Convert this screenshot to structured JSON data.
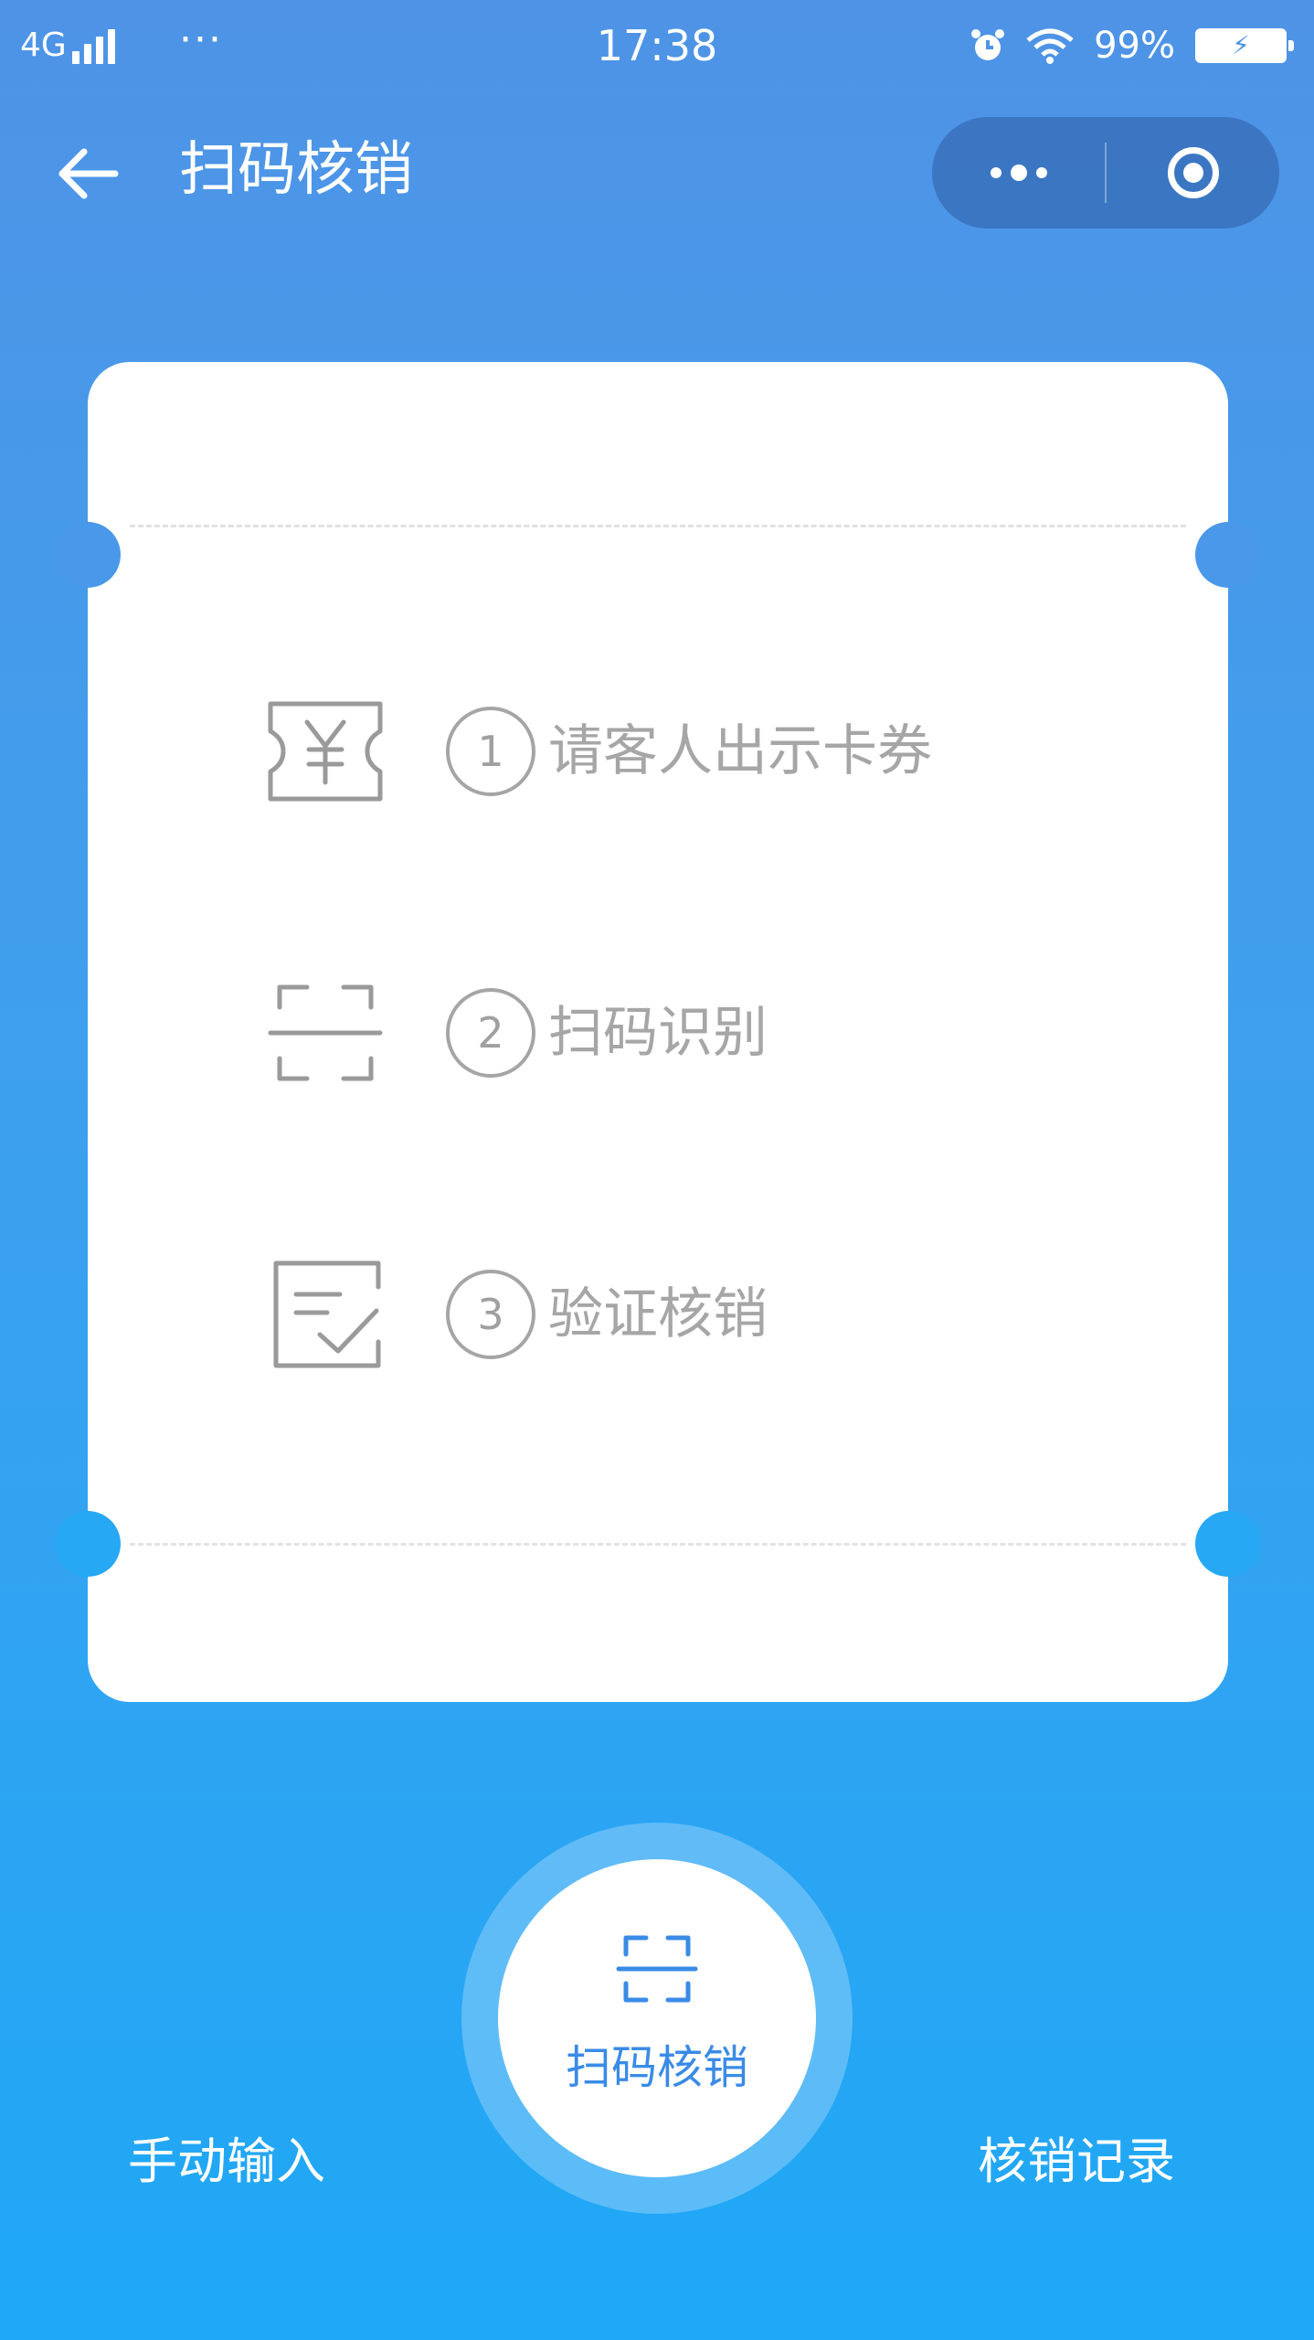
{
  "status_bar": {
    "network": "4G",
    "dots": "···",
    "time": "17:38",
    "battery": "99%",
    "icons": [
      "signal-icon",
      "alarm-icon",
      "wifi-icon",
      "battery-icon"
    ]
  },
  "nav": {
    "title": "扫码核销",
    "back_icon": "arrow-left-icon",
    "more_icon": "more-dots-icon",
    "close_icon": "target-circle-icon"
  },
  "steps": [
    {
      "number": "1",
      "text": "请客人出示卡券",
      "icon": "yen-ticket-icon"
    },
    {
      "number": "2",
      "text": "扫码识别",
      "icon": "scan-frame-icon"
    },
    {
      "number": "3",
      "text": "验证核销",
      "icon": "verify-check-icon"
    }
  ],
  "actions": {
    "manual_input": "手动输入",
    "scan_label": "扫码核销",
    "records": "核销记录"
  },
  "colors": {
    "background_top": "#4f93e6",
    "background_bottom": "#1ea8f6",
    "card": "#ffffff",
    "step_text": "#a6a6a6",
    "scan_label": "#3a8be6"
  }
}
